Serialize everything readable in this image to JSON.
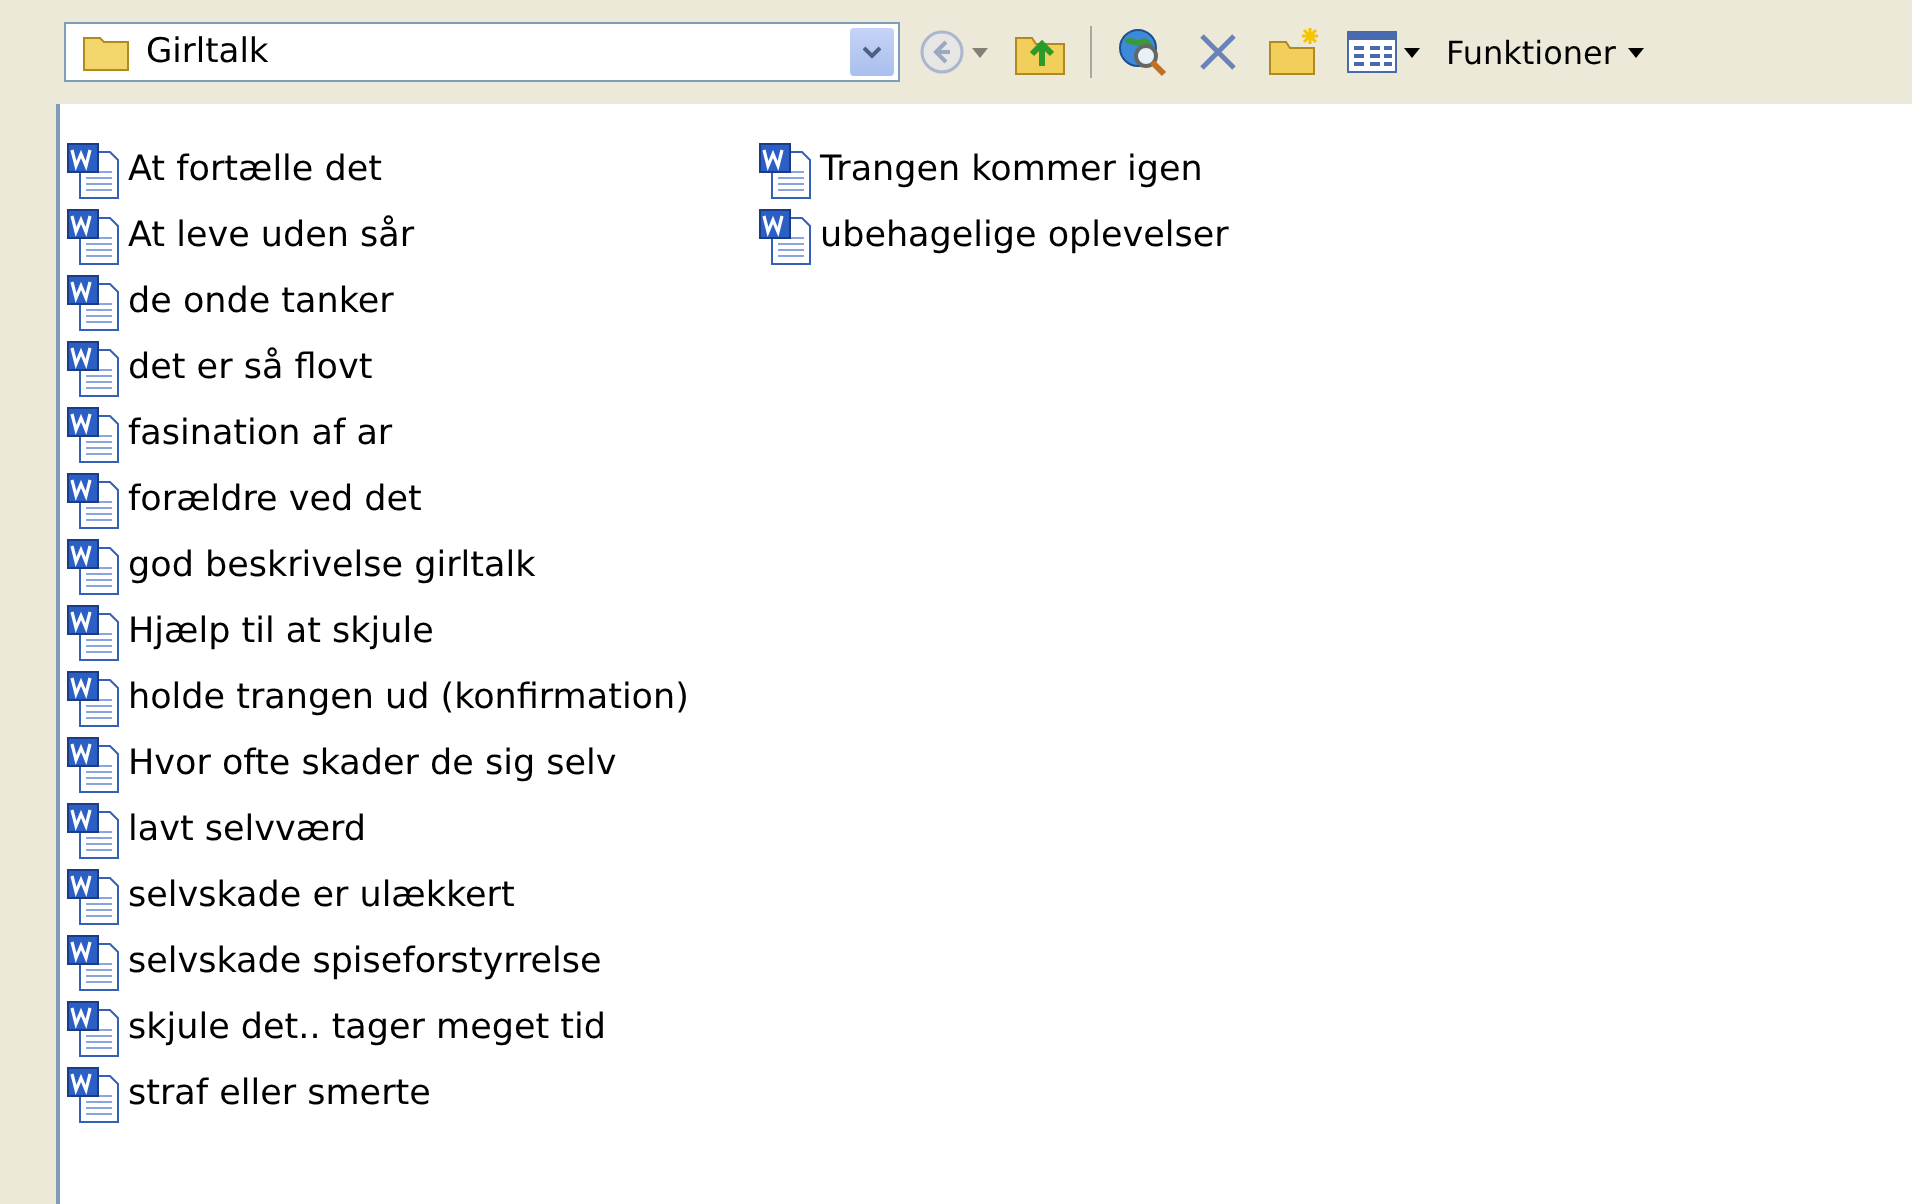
{
  "location": {
    "value": "Girltalk"
  },
  "toolbar": [
    {
      "kind": "back",
      "disabled": true
    },
    {
      "kind": "up",
      "disabled": false
    },
    {
      "kind": "separator"
    },
    {
      "kind": "search",
      "disabled": false
    },
    {
      "kind": "delete",
      "disabled": false
    },
    {
      "kind": "newfolder",
      "disabled": false
    },
    {
      "kind": "views",
      "disabled": false
    }
  ],
  "menu": {
    "label": "Funktioner"
  },
  "files": [
    [
      {
        "name": "At fortælle det"
      },
      {
        "name": "At leve uden sår"
      },
      {
        "name": "de onde tanker"
      },
      {
        "name": "det er så flovt"
      },
      {
        "name": "fasination af ar"
      },
      {
        "name": "forældre ved det"
      },
      {
        "name": "god beskrivelse girltalk"
      },
      {
        "name": "Hjælp til at skjule"
      },
      {
        "name": "holde trangen ud (konfirmation)"
      },
      {
        "name": "Hvor ofte skader de sig selv"
      },
      {
        "name": "lavt selvværd"
      },
      {
        "name": "selvskade er ulækkert"
      },
      {
        "name": "selvskade spiseforstyrrelse"
      },
      {
        "name": "skjule det.. tager meget tid"
      },
      {
        "name": "straf eller smerte"
      }
    ],
    [
      {
        "name": "Trangen kommer igen"
      },
      {
        "name": "ubehagelige oplevelser"
      }
    ]
  ]
}
